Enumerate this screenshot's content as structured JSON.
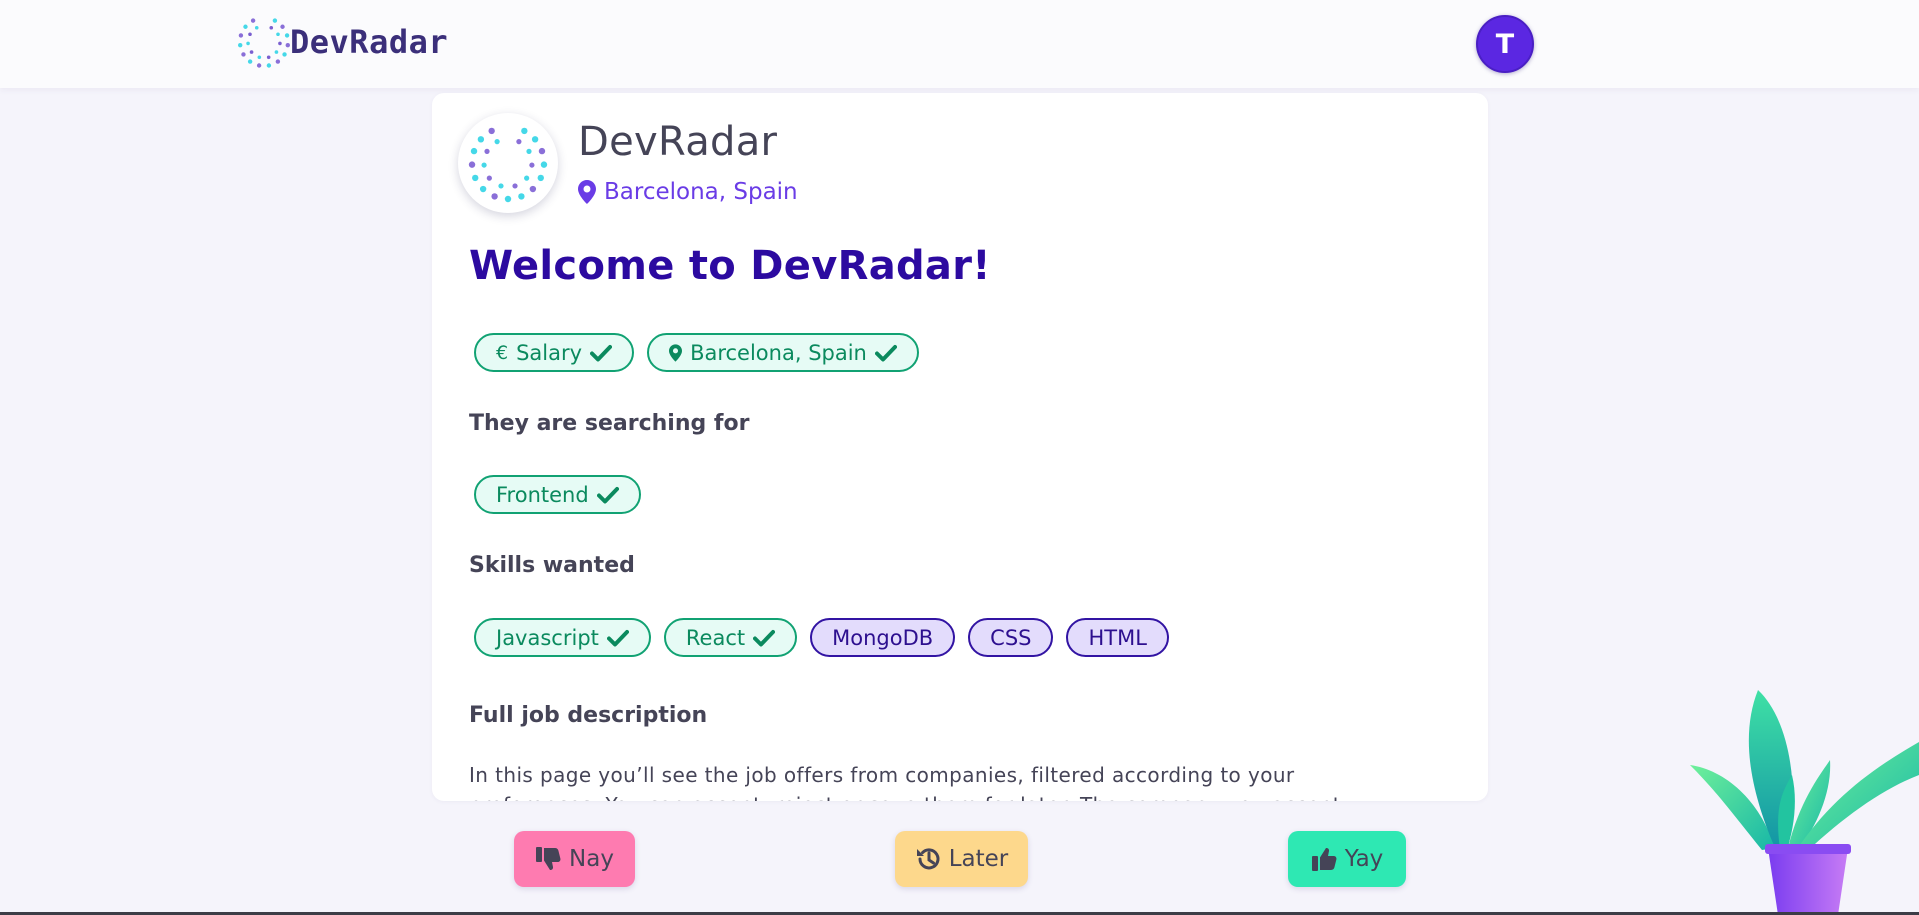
{
  "header": {
    "brand_name": "DevRadar",
    "avatar_initial": "T",
    "avatar_color": "#5b27e2"
  },
  "company": {
    "name": "DevRadar",
    "location": "Barcelona, Spain",
    "logo_icon": "radar-dots-logo"
  },
  "offer": {
    "title": "Welcome to DevRadar!",
    "summary_chips": [
      {
        "label": "Salary",
        "icon": "euro-icon",
        "matched": true
      },
      {
        "label": "Barcelona, Spain",
        "icon": "map-pin-icon",
        "matched": true
      }
    ],
    "searching_title": "They are searching for",
    "searching_chips": [
      {
        "label": "Frontend",
        "matched": true
      }
    ],
    "skills_title": "Skills wanted",
    "skills_chips": [
      {
        "label": "Javascript",
        "matched": true
      },
      {
        "label": "React",
        "matched": true
      },
      {
        "label": "MongoDB",
        "matched": false
      },
      {
        "label": "CSS",
        "matched": false
      },
      {
        "label": "HTML",
        "matched": false
      }
    ],
    "description_title": "Full job description",
    "description": "In this page you’ll see the job offers from companies, filtered according to your preferences. You can accept, reject or save them for later. The company you accept will"
  },
  "actions": {
    "nay_label": "Nay",
    "later_label": "Later",
    "yay_label": "Yay"
  },
  "colors": {
    "match_bg": "#e6fbf5",
    "match_border": "#11a273",
    "nomatch_bg": "#e3dcfc",
    "nomatch_border": "#3214a3",
    "nay": "#fe7bb0",
    "later": "#fdd88c",
    "yay": "#2ee8b3"
  }
}
